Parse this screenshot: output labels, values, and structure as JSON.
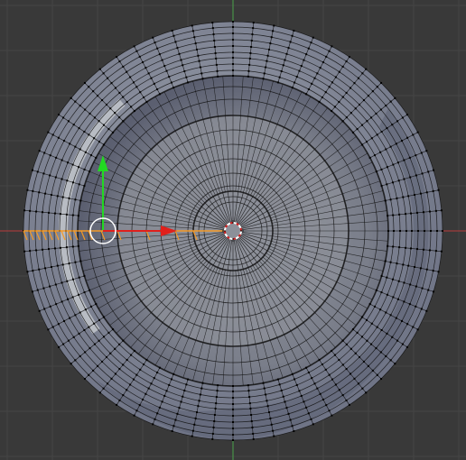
{
  "viewport": {
    "view": "top-orthographic",
    "mode": "edit-mode",
    "background_color": "#393939",
    "grid_color": "#454545"
  },
  "axes": {
    "x_axis_color": "#b93b3b",
    "y_axis_color": "#4aa34a"
  },
  "mesh": {
    "object": "bowl",
    "outer_rim_color": "#8a8f9c",
    "inner_color": "#6a6e7a",
    "wire_color": "#111111",
    "selected_edge_color": "#f59a27"
  },
  "transform_gizmo": {
    "x_arrow_color": "#e0201c",
    "y_arrow_color": "#22d922"
  },
  "icons": [
    "3d-cursor-icon",
    "object-origin-icon",
    "translate-gizmo-icon"
  ]
}
